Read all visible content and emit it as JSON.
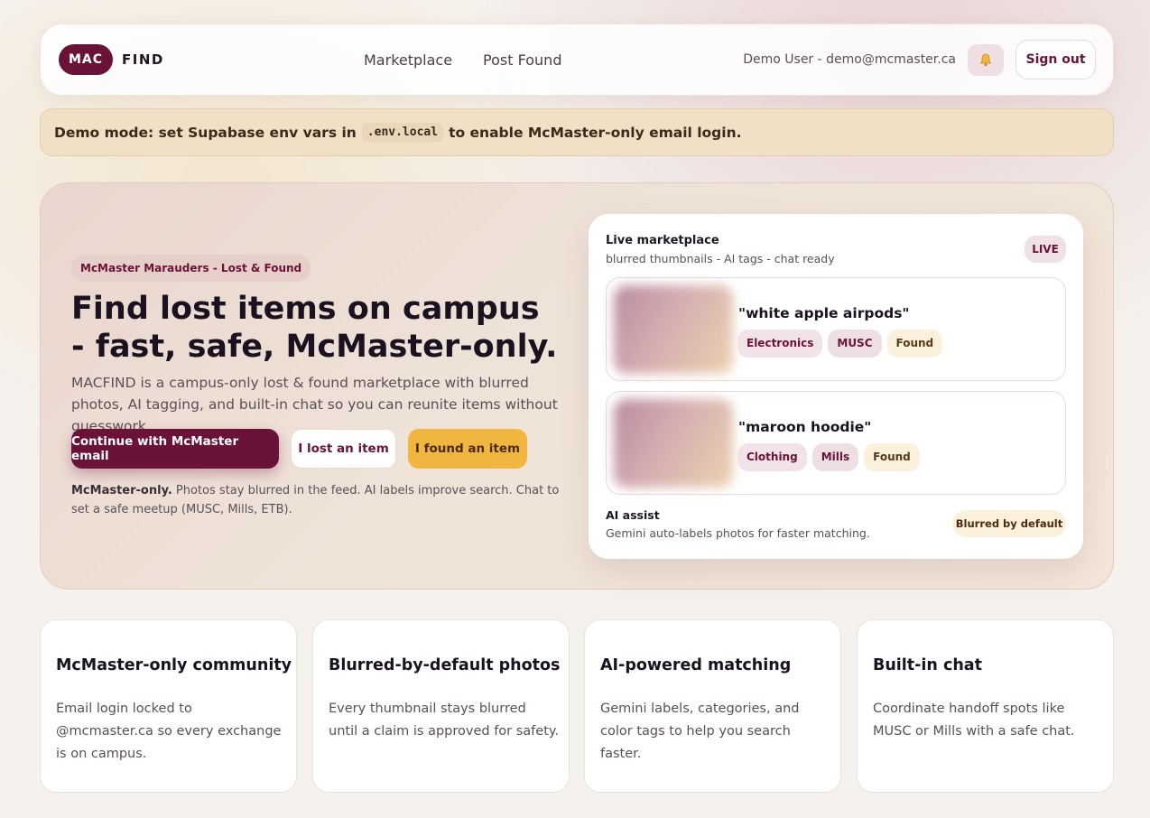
{
  "header": {
    "logo_mac": "MAC",
    "logo_find": "FIND",
    "nav": [
      "Marketplace",
      "Post Found"
    ],
    "user": "Demo User - demo@mcmaster.ca",
    "bell_icon": "bell-icon",
    "signout": "Sign out"
  },
  "banner": {
    "before": "Demo mode: set Supabase env vars in",
    "code": ".env.local",
    "after": "to enable McMaster-only email login."
  },
  "hero": {
    "tag": "McMaster Marauders - Lost & Found",
    "title": "Find lost items on campus - fast, safe, McMaster-only.",
    "description": "MACFIND is a campus-only lost & found marketplace with blurred photos, AI tagging, and built-in chat so you can reunite items without guesswork.",
    "buttons": {
      "primary": "Continue with McMaster email",
      "lost": "I lost an item",
      "found": "I found an item"
    },
    "note_bold": "McMaster-only.",
    "note": " Photos stay blurred in the feed. AI labels improve search. Chat to set a safe meetup (MUSC, Mills, ETB)."
  },
  "marketplace": {
    "title": "Live marketplace",
    "subtitle": "blurred thumbnails - AI tags - chat ready",
    "live_badge": "LIVE",
    "items": [
      {
        "title": "\"white apple airpods\"",
        "category": "Electronics",
        "location": "MUSC",
        "status": "Found"
      },
      {
        "title": "\"maroon hoodie\"",
        "category": "Clothing",
        "location": "Mills",
        "status": "Found"
      }
    ],
    "ai_title": "AI assist",
    "ai_subtitle": "Gemini auto-labels photos for faster matching.",
    "blurred_badge": "Blurred by default"
  },
  "features": [
    {
      "title": "McMaster-only community",
      "description": "Email login locked to @mcmaster.ca so every exchange is on campus."
    },
    {
      "title": "Blurred-by-default photos",
      "description": "Every thumbnail stays blurred until a claim is approved for safety."
    },
    {
      "title": "AI-powered matching",
      "description": "Gemini labels, categories, and color tags to help you search faster."
    },
    {
      "title": "Built-in chat",
      "description": "Coordinate handoff spots like MUSC or Mills with a safe chat."
    }
  ],
  "colors": {
    "brand": "#6b1239",
    "accent": "#f0b63f",
    "banner_bg": "#f1dfc6"
  }
}
